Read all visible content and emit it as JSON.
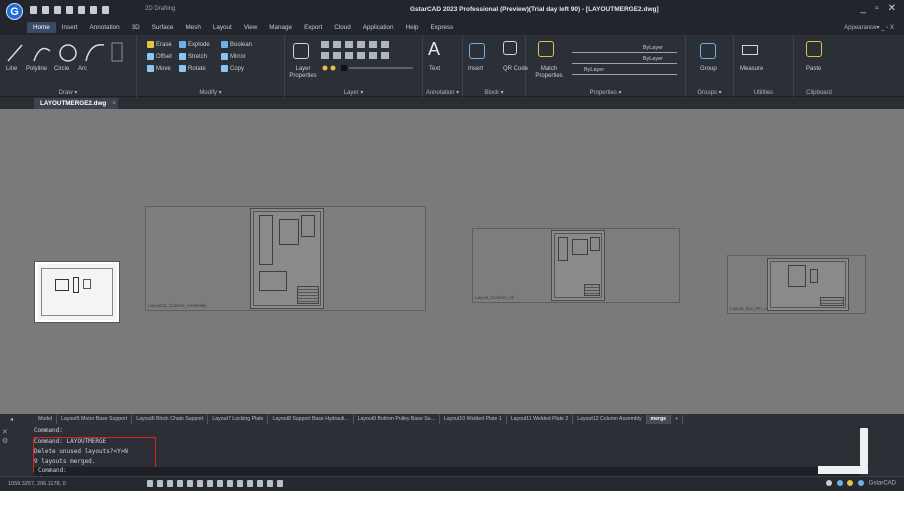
{
  "titlebar": {
    "logo_letter": "G",
    "workspace": "2D Drafting",
    "title": "GstarCAD 2023 Professional (Preview)(Trial day left 90) - [LAYOUTMERGE2.dwg]",
    "buttons": [
      "_",
      "▫",
      "✕"
    ]
  },
  "menu": {
    "tabs": [
      "Home",
      "Insert",
      "Annotation",
      "3D",
      "Surface",
      "Mesh",
      "Layout",
      "View",
      "Manage",
      "Export",
      "Cloud",
      "Application",
      "Help",
      "Express"
    ],
    "active": "Home",
    "appearance": "Appearance▾ _ ▫ X"
  },
  "ribbon": {
    "draw": {
      "title": "Draw ▾",
      "tools": [
        "Line",
        "Polyline",
        "Circle",
        "Arc"
      ]
    },
    "modify": {
      "title": "Modify ▾",
      "tools": [
        "Erase",
        "Explode",
        "Boolean",
        "Offset",
        "Stretch",
        "Mirror",
        "Move",
        "Rotate",
        "Copy"
      ]
    },
    "layer": {
      "title": "Layer ▾",
      "tools": [
        "Layer Properties"
      ]
    },
    "annotation": {
      "title": "Annotation ▾",
      "tools": [
        "Text"
      ]
    },
    "block": {
      "title": "Block ▾",
      "tools": [
        "Insert",
        "QR Code"
      ]
    },
    "properties": {
      "title": "Properties ▾",
      "tools": [
        "Match Properties"
      ],
      "bylayer": [
        "ByLayer",
        "ByLayer",
        "ByLayer"
      ]
    },
    "groups": {
      "title": "Groups ▾",
      "tools": [
        "Group"
      ]
    },
    "utilities": {
      "title": "Utilities",
      "tools": [
        "Measure"
      ]
    },
    "clipboard": {
      "title": "Clipboard",
      "tools": [
        "Paste"
      ]
    }
  },
  "document_tab": {
    "name": "LAYOUTMERGE2.dwg",
    "close": "×"
  },
  "drawing": {
    "sheet_labels": [
      "Layout12_Column_Assembly",
      "Layout_Column_All",
      "Layout_Bot_Pin_Assy"
    ]
  },
  "layout_tabs": {
    "nav": "◂",
    "tabs": [
      "Model",
      "Layout5 Motor Base Support",
      "Layout6 Block Chain Support",
      "Layout7 Locking Plate",
      "Layout8 Support Base Hydrauli...",
      "Layout9 Bottom Pulley Base Su...",
      "Layout10 Welded Plate 1",
      "Layout11 Welded Plate 2",
      "Layout12 Column Assembly",
      "merge",
      "+"
    ],
    "current": "merge"
  },
  "command": {
    "history": [
      "Command:",
      "Command: LAYOUTMERGE",
      "Delete unused layouts?<Y>N",
      "9 layouts merged."
    ],
    "prompt": "Command:"
  },
  "status": {
    "coords": "1059.3257, 206.1178, 0",
    "right_label": "GstarCAD"
  }
}
